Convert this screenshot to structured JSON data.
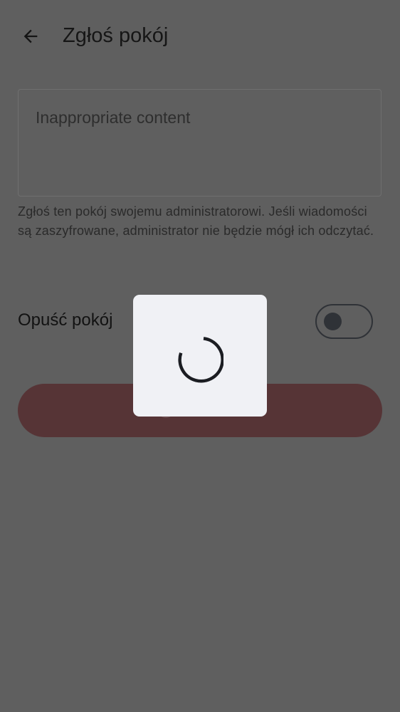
{
  "header": {
    "back_icon": "arrow-back-icon",
    "title": "Zgłoś pokój"
  },
  "report_form": {
    "reason_value": "Inappropriate content",
    "helper_text": "Zgłoś ten pokój swojemu administratorowi. Jeśli wiadomości są zaszyfrowane, administrator nie będzie mógł ich odczytać.",
    "leave_room_label": "Opuść pokój",
    "leave_room_toggle_on": false,
    "submit_icon": "spinner-icon"
  },
  "loading_dialog": {
    "icon": "spinner-icon"
  },
  "colors": {
    "scrim": "#5f5f5f",
    "dialog_bg": "#f0f1f5",
    "submit_button_bg": "#563436",
    "spinner": "#1b1d22"
  }
}
